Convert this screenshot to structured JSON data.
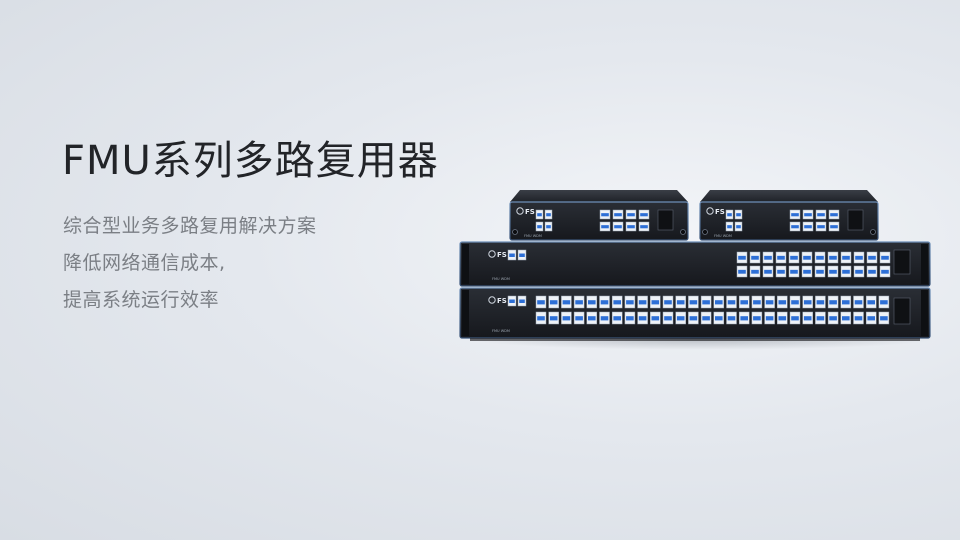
{
  "headline": "FMU系列多路复用器",
  "subtitle_lines": [
    "综合型业务多路复用解决方案",
    "降低网络通信成本,",
    "提高系统运行效率"
  ],
  "product": {
    "brand_mark": "FS",
    "unit_labels": [
      "FMU WDM",
      "FMU WDM",
      "FMU WDM",
      "FMU WDM"
    ]
  },
  "colors": {
    "headline": "#222428",
    "subtitle": "#7b7f85",
    "chassis": "#1e2127",
    "port_blue": "#2d6fd6"
  }
}
